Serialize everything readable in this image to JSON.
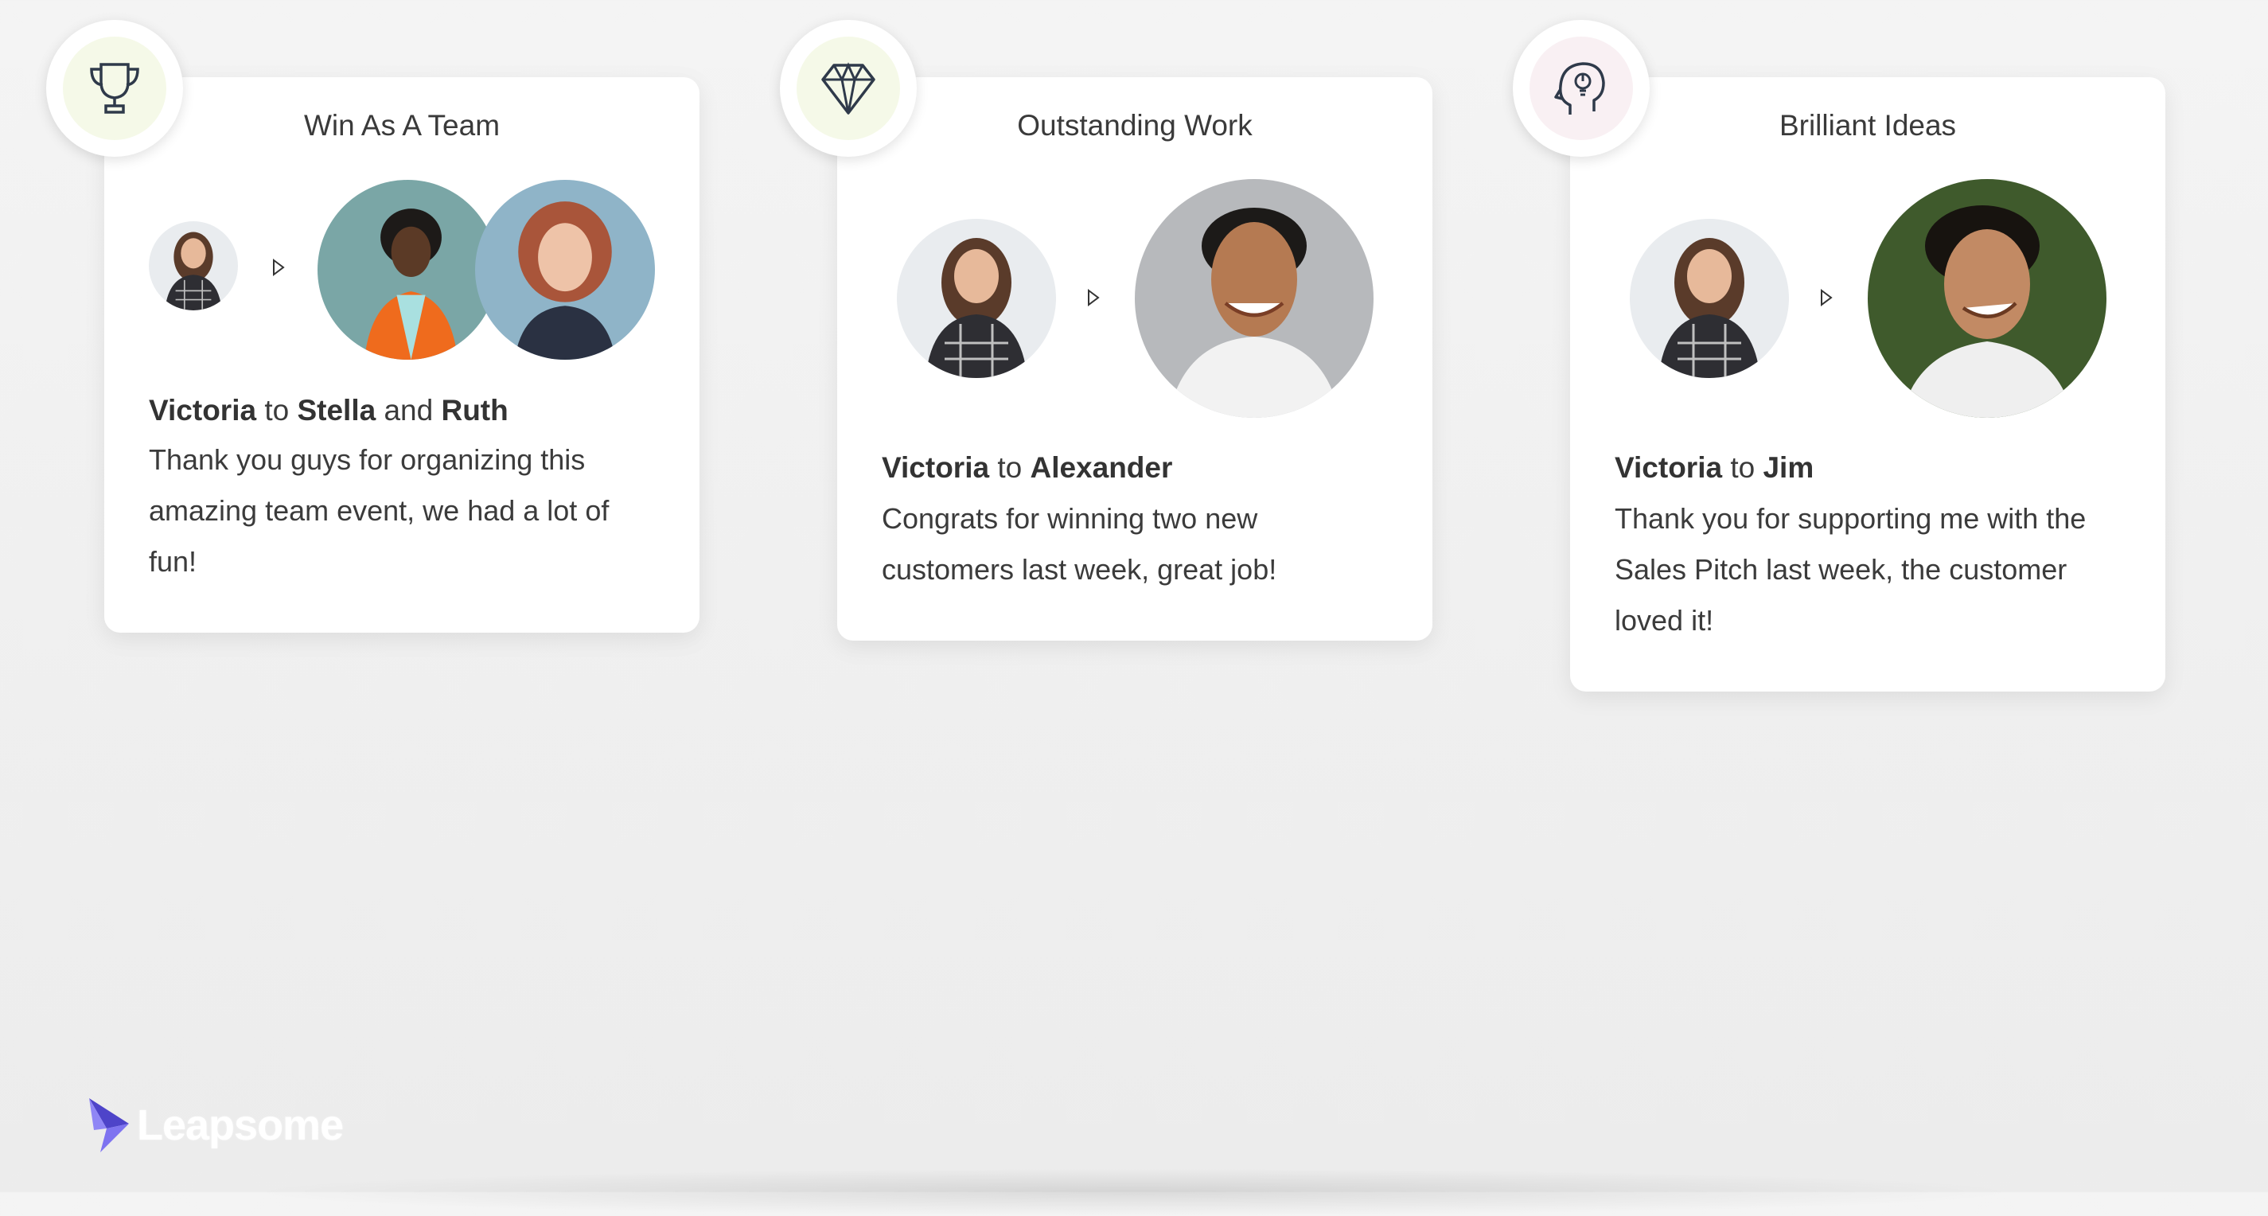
{
  "colors": {
    "accent": "#6a5cd8",
    "card_bg": "#ffffff"
  },
  "cards": [
    {
      "title": "Win As A Team",
      "icon": "trophy-icon",
      "sender": "Victoria",
      "connector": "to",
      "recipient1": "Stella",
      "and": "and",
      "recipient2": "Ruth",
      "message_lines": [
        "Thank you guys for organizing this",
        "amazing team event, we had a lot of",
        "fun!"
      ]
    },
    {
      "title": "Outstanding Work",
      "icon": "diamond-icon",
      "sender": "Victoria",
      "connector": "to",
      "recipient1": "Alexander",
      "message_lines": [
        "Congrats for winning two new",
        "customers last week, great job!"
      ]
    },
    {
      "title": "Brilliant Ideas",
      "icon": "head-lightbulb-icon",
      "sender": "Victoria",
      "connector": "to",
      "recipient1": "Jim",
      "message_lines": [
        "Thank you for supporting me with the",
        "Sales Pitch last week, the customer",
        "loved it!"
      ]
    }
  ],
  "brand": {
    "name": "Leapsome",
    "icon": "leapsome-bird-icon"
  }
}
